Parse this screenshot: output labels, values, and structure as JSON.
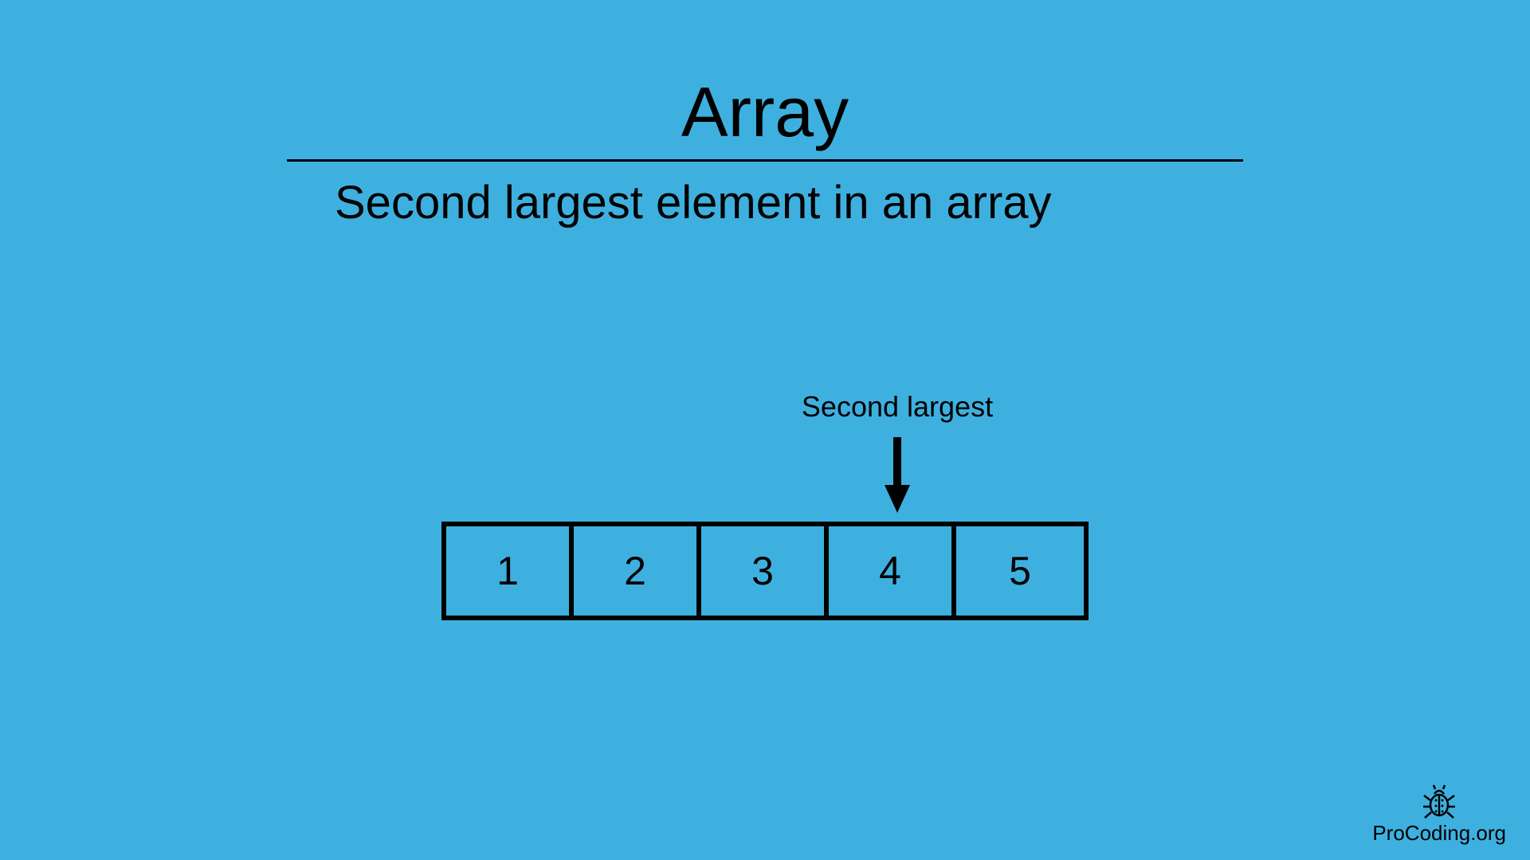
{
  "title": "Array",
  "subtitle": "Second largest element in an array",
  "pointer_label": "Second largest",
  "array": [
    "1",
    "2",
    "3",
    "4",
    "5"
  ],
  "pointer_index": 3,
  "brand": "ProCoding.org"
}
